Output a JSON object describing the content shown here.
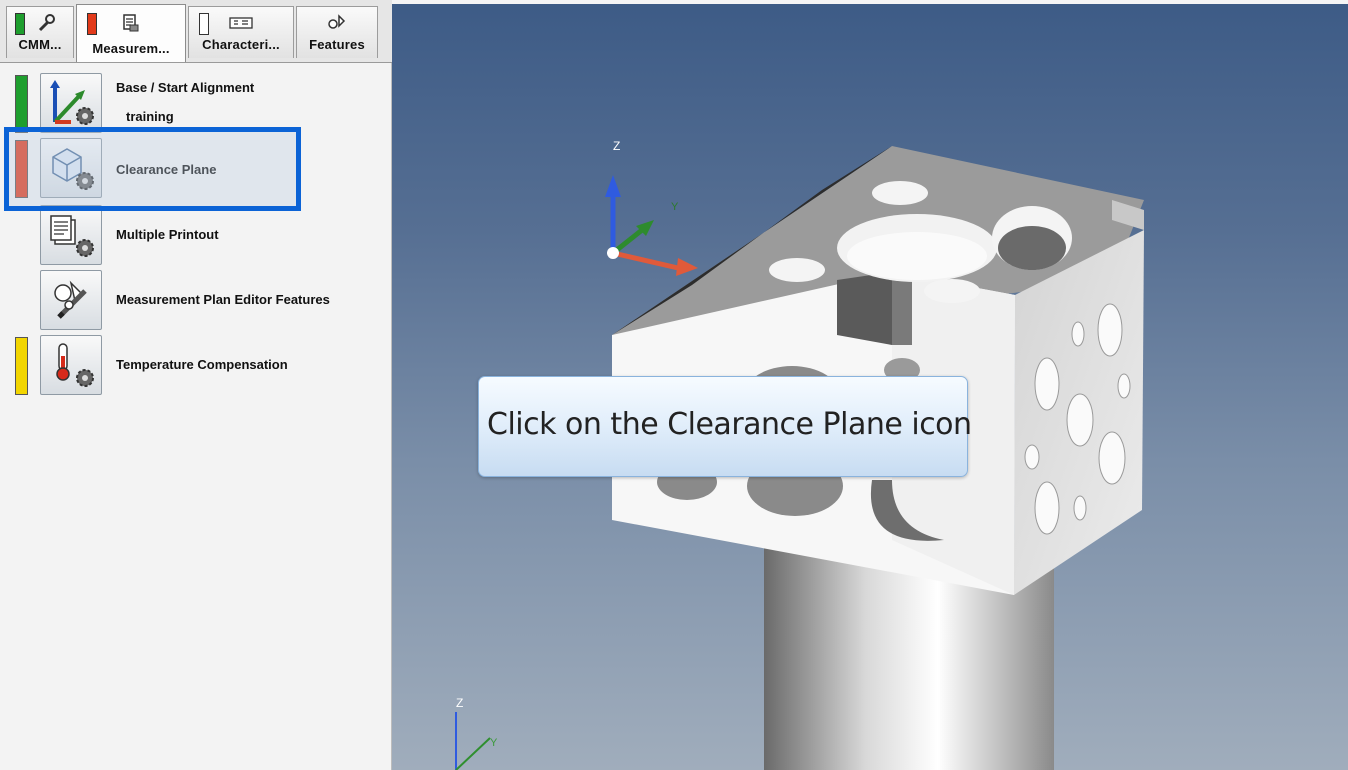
{
  "tabs": [
    {
      "label": "CMM...",
      "status_color": "#1e9e2e",
      "icon": "wrench-icon"
    },
    {
      "label": "Measurem...",
      "status_color": "#e23a1a",
      "icon": "measurement-plan-icon",
      "active": true
    },
    {
      "label": "Characteri...",
      "status_color": "#ffffff",
      "icon": "characteristic-icon"
    },
    {
      "label": "Features",
      "icon": "features-icon"
    }
  ],
  "plan_items": [
    {
      "label": "Base / Start Alignment",
      "sublabel": "training",
      "status_color": "#1e9e2e",
      "icon": "alignment-icon"
    },
    {
      "label": "Clearance Plane",
      "status_color": "#e23a1a",
      "icon": "clearance-plane-icon",
      "highlighted": true
    },
    {
      "label": "Multiple Printout",
      "status_color": null,
      "icon": "printout-icon"
    },
    {
      "label": "Measurement Plan Editor Features",
      "status_color": null,
      "icon": "editor-features-icon"
    },
    {
      "label": "Temperature Compensation",
      "status_color": "#f2d500",
      "icon": "thermometer-icon"
    }
  ],
  "callout": {
    "text": "Click on the Clearance Plane icon"
  },
  "axes": {
    "main_z": "Z",
    "main_y": "Y",
    "small_z": "Z",
    "small_y": "Y"
  },
  "colors": {
    "highlight": "#0b63d6",
    "viewport_top": "#3d5b86",
    "viewport_bottom": "#a0adbc"
  }
}
